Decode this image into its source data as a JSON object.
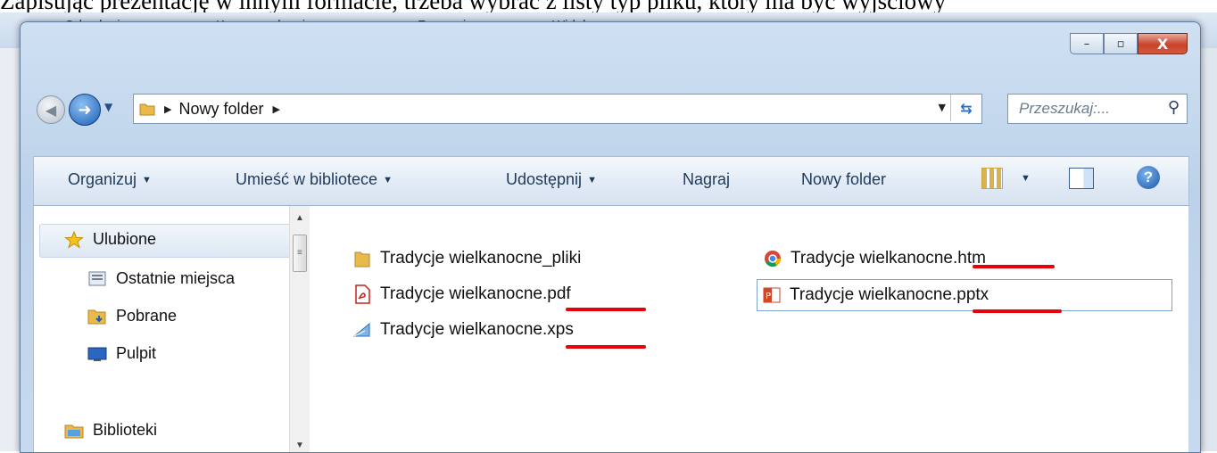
{
  "background_document": {
    "text": "Zapisując prezentację w innym formacie, trzeba wybrać z listy typ pliku, który ma być wyjściowy",
    "ribbon_tabs": [
      "Odwołania",
      "Korespondencja",
      "Recenzja",
      "Widok"
    ]
  },
  "window": {
    "controls": {
      "minimize": "–",
      "maximize": "▫",
      "close": "X"
    }
  },
  "address_bar": {
    "crumbs": [
      "Nowy folder"
    ],
    "search_placeholder": "Przeszukaj:..."
  },
  "toolbar": {
    "organize": "Organizuj",
    "include_in_library": "Umieść w bibliotece",
    "share": "Udostępnij",
    "burn": "Nagraj",
    "new_folder": "Nowy folder"
  },
  "nav_pane": {
    "favorites": "Ulubione",
    "recent": "Ostatnie miejsca",
    "downloads": "Pobrane",
    "desktop": "Pulpit",
    "libraries": "Biblioteki"
  },
  "files": [
    {
      "name": "Tradycje wielkanocne_pliki",
      "icon": "folder-icon"
    },
    {
      "name": "Tradycje wielkanocne.pdf",
      "icon": "pdf-icon"
    },
    {
      "name": "Tradycje wielkanocne.xps",
      "icon": "xps-icon"
    },
    {
      "name": "Tradycje wielkanocne.htm",
      "icon": "chrome-icon"
    },
    {
      "name": "Tradycje wielkanocne.pptx",
      "icon": "powerpoint-icon"
    }
  ],
  "colors": {
    "highlight_underline": "#e8000a",
    "accent": "#1a5eb6"
  }
}
